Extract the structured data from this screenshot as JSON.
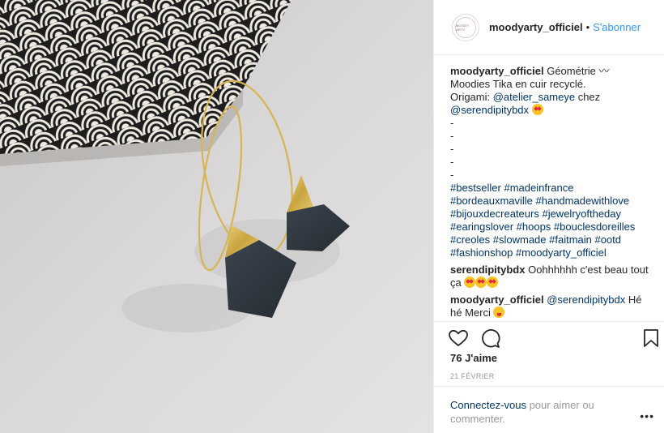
{
  "header": {
    "avatar_text": "MOODY ARTY",
    "username": "moodyarty_officiel",
    "separator": "•",
    "follow_label": "S'abonner"
  },
  "caption": {
    "username": "moodyarty_officiel",
    "line1": "Géométrie 〰",
    "line2": "Moodies Tika en cuir recyclé.",
    "origami_prefix": "Origami: ",
    "mention1": "@atelier_sameye",
    "mention_between": " chez",
    "mention2": "@serendipitybdx",
    "dashes": [
      "-",
      "-",
      "-",
      "-",
      "-"
    ],
    "hashtag_lines": [
      "#bestseller #madeinfrance",
      "#bordeauxmaville #handmadewithlove",
      "#bijouxdecreateurs #jewelryoftheday",
      "#earingslover #hoops #bouclesdoreilles",
      "#creoles #slowmade #faitmain #ootd",
      "#fashionshop #moodyarty_officiel"
    ]
  },
  "comments": [
    {
      "username": "serendipitybdx",
      "text": "Oohhhhhh c'est beau tout ça"
    },
    {
      "username": "moodyarty_officiel",
      "mention": "@serendipitybdx",
      "text": "Hé hé Merci"
    }
  ],
  "actions": {
    "like_icon": "heart-outline-icon",
    "comment_icon": "speech-bubble-icon",
    "save_icon": "bookmark-icon"
  },
  "likes_text": "76 J'aime",
  "date_text": "21 FÉVRIER",
  "footer": {
    "login_label": "Connectez-vous",
    "rest_text": " pour aimer ou commenter.",
    "more_label": "•••"
  },
  "colors": {
    "link_blue": "#3897f0",
    "mention_dark": "#003569",
    "muted": "#999999",
    "gold": "#d4b24a",
    "leather": "#2f3640"
  }
}
